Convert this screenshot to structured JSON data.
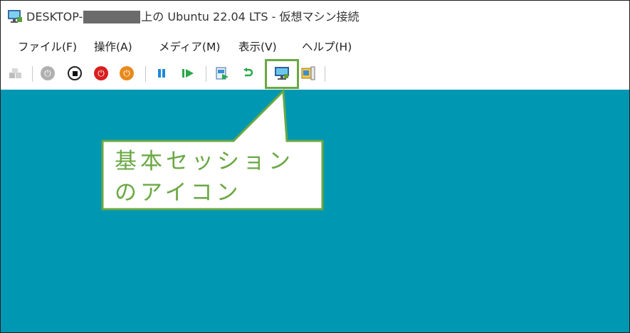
{
  "window": {
    "title_prefix": "DESKTOP-",
    "title_suffix": "上の Ubuntu 22.04 LTS  - 仮想マシン接続"
  },
  "menu": {
    "items": [
      "ファイル(F)",
      "操作(A)",
      "メディア(M)",
      "表示(V)",
      "ヘルプ(H)"
    ]
  },
  "toolbar": {
    "icons": [
      "ctrl-alt-del-icon",
      "start-icon",
      "turn-off-icon",
      "shutdown-icon",
      "save-icon",
      "pause-icon",
      "resume-icon",
      "checkpoint-icon",
      "revert-icon",
      "basic-session-icon",
      "zoom-level-icon"
    ]
  },
  "callout": {
    "line1": "基本セッション",
    "line2": "のアイコン"
  },
  "colors": {
    "guest_background": "#0097b2",
    "callout_accent": "#6aa843"
  }
}
